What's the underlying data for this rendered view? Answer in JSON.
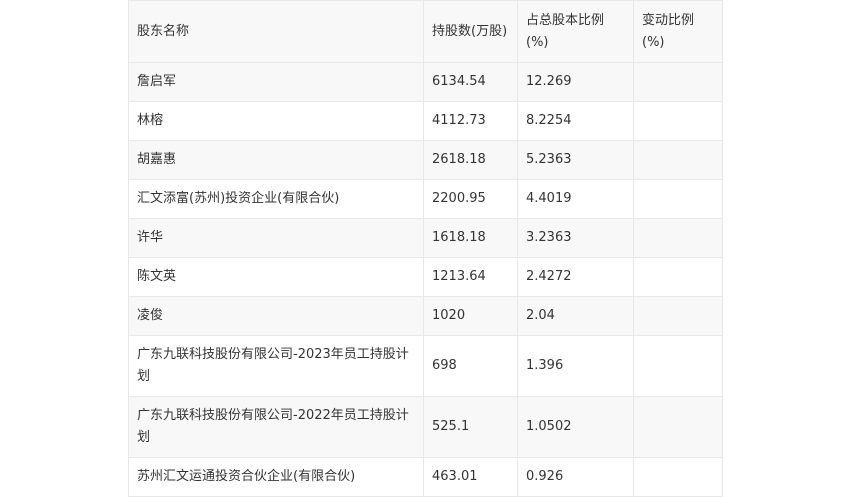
{
  "table": {
    "headers": [
      "股东名称",
      "持股数(万股)",
      "占总股本比例(%)",
      "变动比例(%)"
    ],
    "rows": [
      {
        "name": "詹启军",
        "shares": "6134.54",
        "ratio": "12.269",
        "change": ""
      },
      {
        "name": "林榕",
        "shares": "4112.73",
        "ratio": "8.2254",
        "change": ""
      },
      {
        "name": "胡嘉惠",
        "shares": "2618.18",
        "ratio": "5.2363",
        "change": ""
      },
      {
        "name": "汇文添富(苏州)投资企业(有限合伙)",
        "shares": "2200.95",
        "ratio": "4.4019",
        "change": ""
      },
      {
        "name": "许华",
        "shares": "1618.18",
        "ratio": "3.2363",
        "change": ""
      },
      {
        "name": "陈文英",
        "shares": "1213.64",
        "ratio": "2.4272",
        "change": ""
      },
      {
        "name": "凌俊",
        "shares": "1020",
        "ratio": "2.04",
        "change": ""
      },
      {
        "name": "广东九联科技股份有限公司-2023年员工持股计划",
        "shares": "698",
        "ratio": "1.396",
        "change": ""
      },
      {
        "name": "广东九联科技股份有限公司-2022年员工持股计划",
        "shares": "525.1",
        "ratio": "1.0502",
        "change": ""
      },
      {
        "name": "苏州汇文运通投资合伙企业(有限合伙)",
        "shares": "463.01",
        "ratio": "0.926",
        "change": ""
      }
    ]
  }
}
